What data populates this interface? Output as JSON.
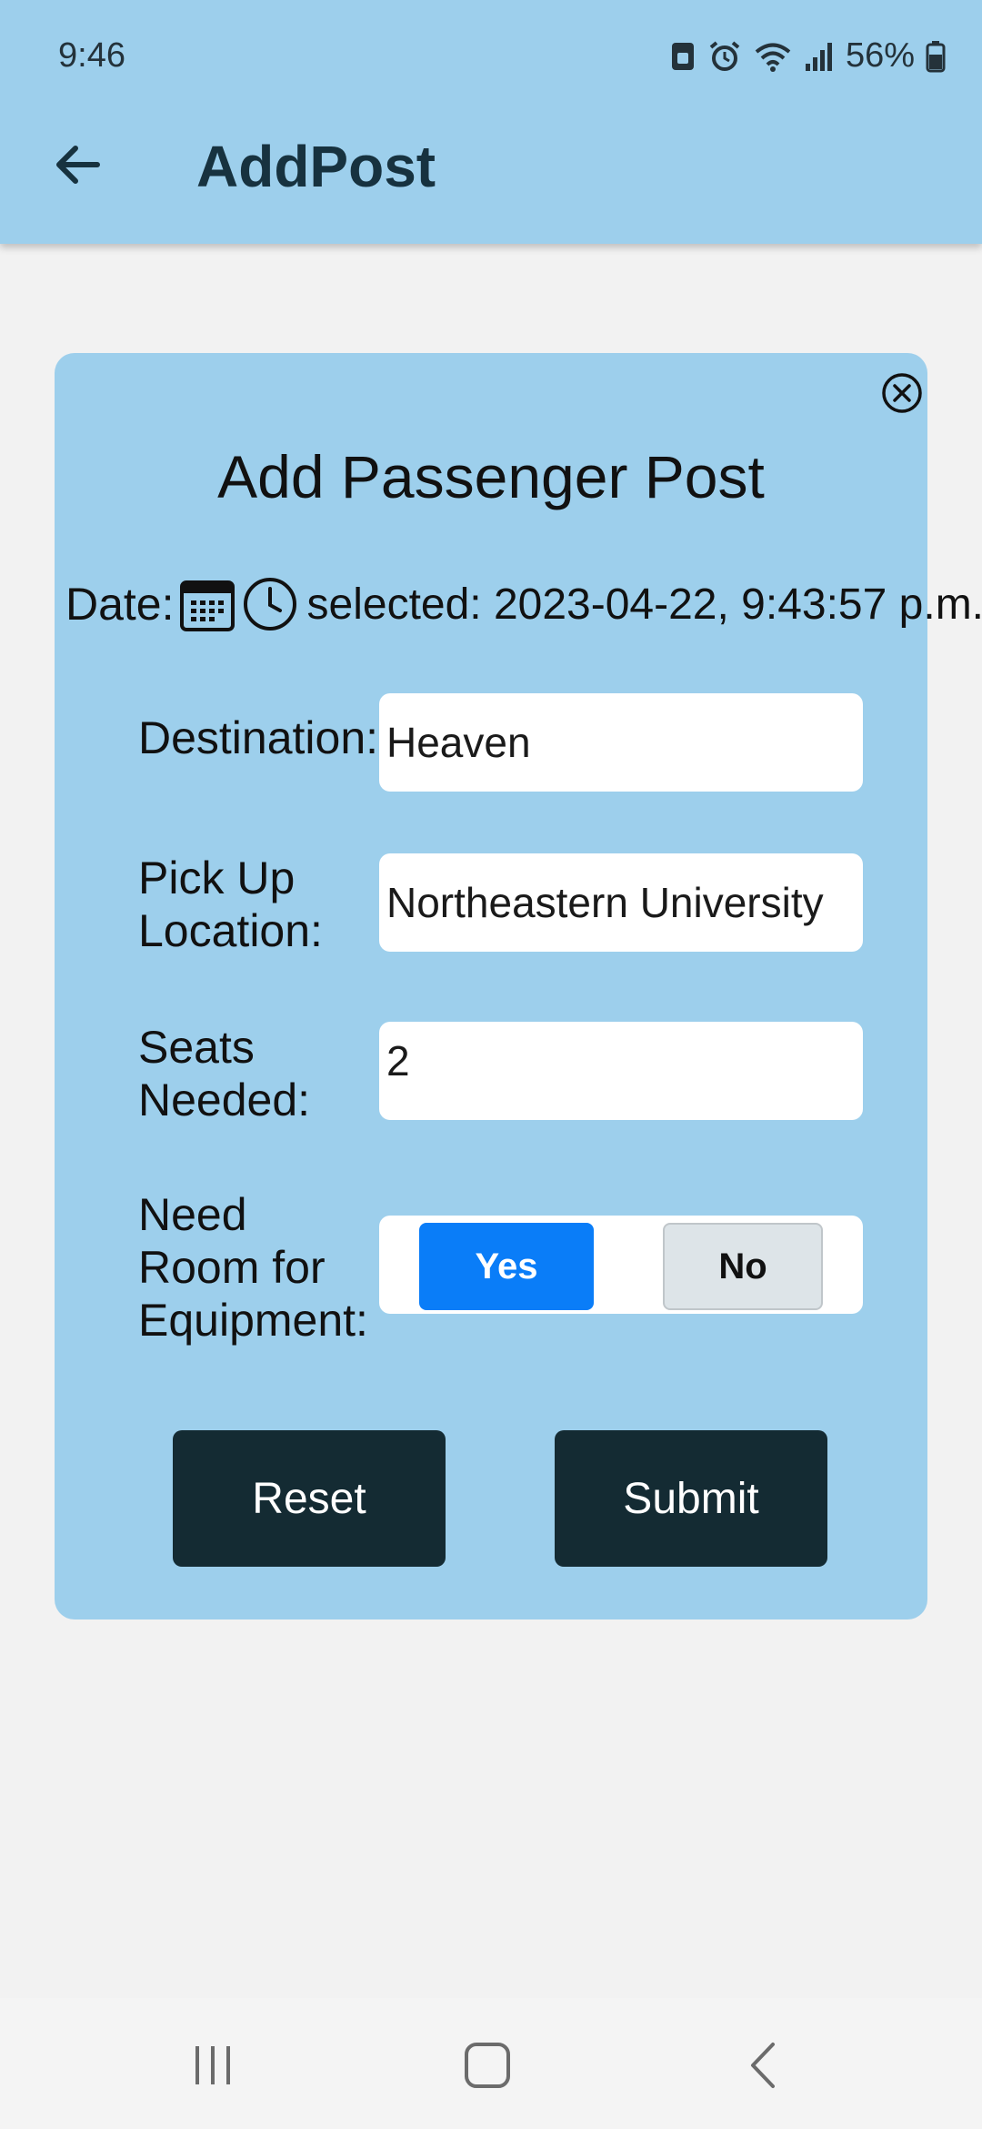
{
  "status_bar": {
    "time": "9:46",
    "battery": "56%",
    "icons": [
      "sim-icon",
      "alarm-icon",
      "wifi-icon",
      "signal-icon",
      "battery-icon"
    ]
  },
  "appbar": {
    "title": "AddPost",
    "back_icon": "arrow-left-icon"
  },
  "dialog": {
    "title": "Add Passenger Post",
    "close_icon": "close-circle-icon",
    "date": {
      "label": "Date:",
      "calendar_icon": "calendar-icon",
      "clock_icon": "clock-icon",
      "selected": "selected: 2023-04-22, 9:43:57 p.m."
    },
    "destination": {
      "label": "Destination:",
      "value": "Heaven"
    },
    "pickup": {
      "label_line1": "Pick Up",
      "label_line2": "Location:",
      "value": "Northeastern University"
    },
    "seats": {
      "label_line1": "Seats",
      "label_line2": "Needed:",
      "value": "2"
    },
    "equipment": {
      "label_line1": "Need",
      "label_line2": "Room for",
      "label_line3": "Equipment:",
      "yes_label": "Yes",
      "no_label": "No",
      "selected": "Yes"
    },
    "reset_label": "Reset",
    "submit_label": "Submit"
  },
  "colors": {
    "header_bg": "#9dcfec",
    "card_bg": "#9dcfec",
    "button_dark": "#142b33",
    "toggle_active": "#0a7df8"
  },
  "nav_bar": {
    "icons": [
      "recent-apps-icon",
      "home-icon",
      "back-icon"
    ]
  }
}
